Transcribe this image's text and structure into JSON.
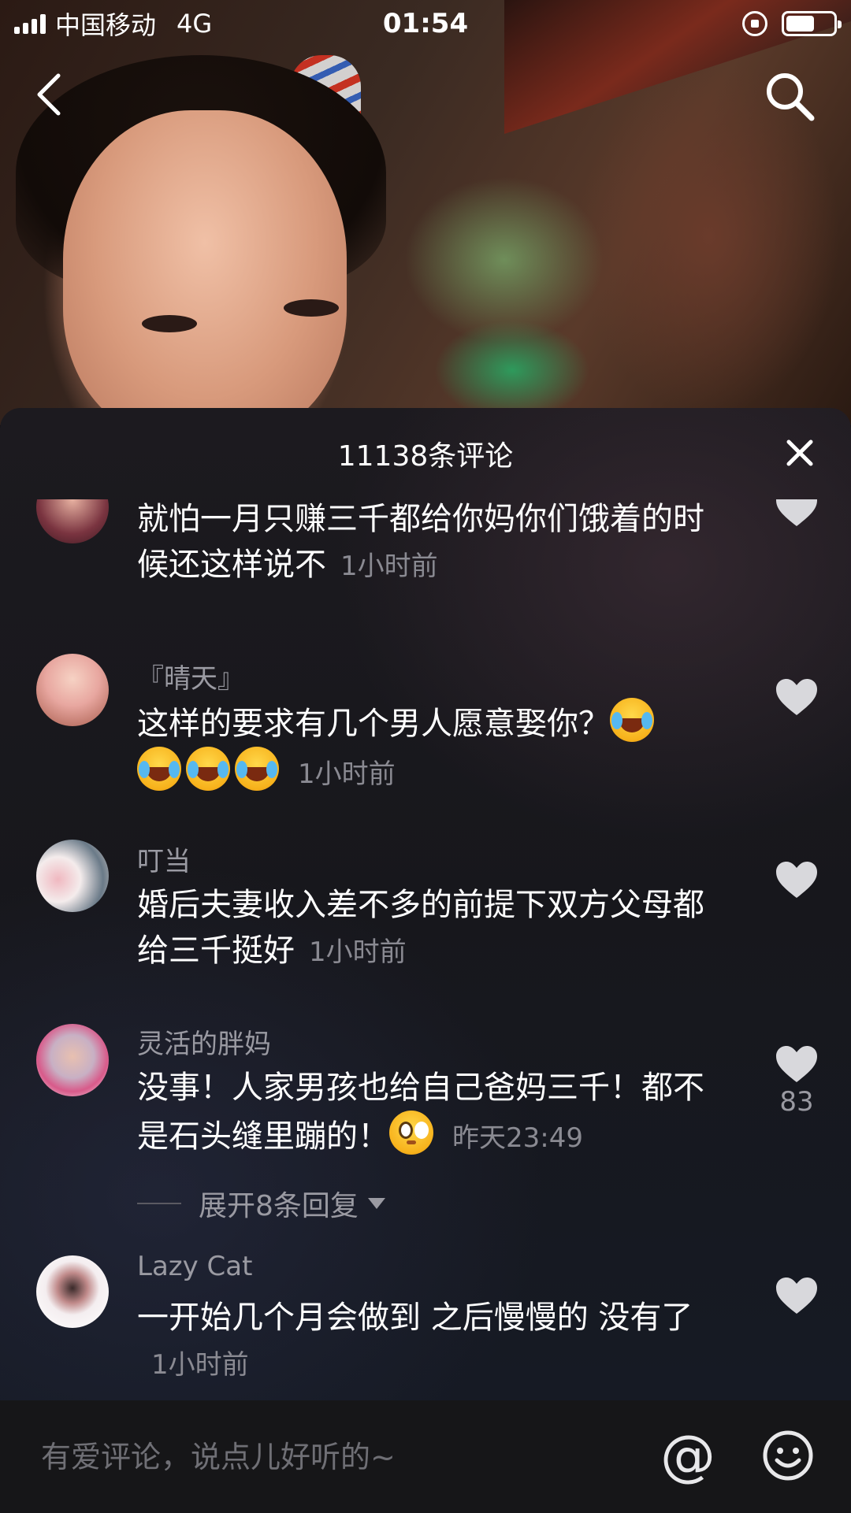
{
  "status_bar": {
    "carrier": "中国移动",
    "network": "4G",
    "time": "01:54",
    "battery_level": 0.6
  },
  "sheet": {
    "title": "11138条评论"
  },
  "comments": [
    {
      "username": "",
      "text": "就怕一月只赚三千都给你妈你们饿着的时候还这样说不",
      "time": "1小时前",
      "avatar_color": "#7a3440"
    },
    {
      "username": "『晴天』",
      "text": "这样的要求有几个男人愿意娶你？",
      "emoji_icons": [
        "laugh-cry-emoji",
        "laugh-cry-emoji",
        "laugh-cry-emoji",
        "laugh-cry-emoji"
      ],
      "time": "1小时前",
      "avatar_color": "#e8a7a0"
    },
    {
      "username": "叮当",
      "text": "婚后夫妻收入差不多的前提下双方父母都给三千挺好",
      "time": "1小时前",
      "avatar_color": "#d8cdc8"
    },
    {
      "username": "灵活的胖妈",
      "text": "没事！人家男孩也给自己爸妈三千！都不是石头缝里蹦的！",
      "emoji_icons": [
        "shy-smile-emoji"
      ],
      "time": "昨天23:49",
      "likes": "83",
      "replies_label": "展开8条回复",
      "avatar_color": "#c8b0c4"
    },
    {
      "username": "Lazy Cat",
      "text": "一开始几个月会做到 之后慢慢的 没有了",
      "time": "1小时前",
      "avatar_color": "#f4eef0"
    }
  ],
  "input": {
    "placeholder": "有爱评论，说点儿好听的~",
    "value": ""
  },
  "icons": {
    "back": "chevron-left-icon",
    "search": "search-icon",
    "close": "close-icon",
    "like": "heart-icon",
    "mention": "at-icon",
    "emoji": "smiley-icon"
  },
  "colors": {
    "sheet_bg": "#1a1a1f",
    "secondary_text": "#9a9aa2",
    "heart": "#d8d8dc"
  }
}
